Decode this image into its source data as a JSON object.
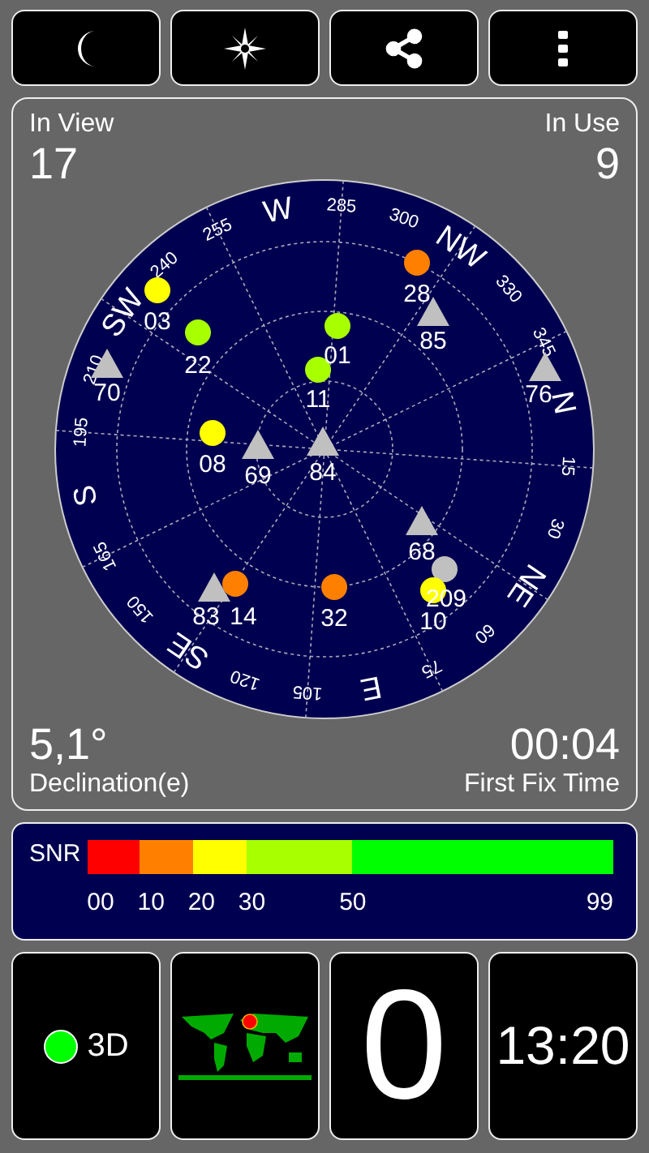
{
  "counts": {
    "in_view_label": "In View",
    "in_view": "17",
    "in_use_label": "In Use",
    "in_use": "9"
  },
  "dial_labels": [
    {
      "text": "N",
      "kind": "direction"
    },
    {
      "text": "15",
      "kind": "degree"
    },
    {
      "text": "30",
      "kind": "degree"
    },
    {
      "text": "NE",
      "kind": "direction"
    },
    {
      "text": "60",
      "kind": "degree"
    },
    {
      "text": "75",
      "kind": "degree"
    },
    {
      "text": "E",
      "kind": "direction"
    },
    {
      "text": "105",
      "kind": "degree"
    },
    {
      "text": "120",
      "kind": "degree"
    },
    {
      "text": "SE",
      "kind": "direction"
    },
    {
      "text": "150",
      "kind": "degree"
    },
    {
      "text": "165",
      "kind": "degree"
    },
    {
      "text": "S",
      "kind": "direction"
    },
    {
      "text": "195",
      "kind": "degree"
    },
    {
      "text": "210",
      "kind": "degree"
    },
    {
      "text": "SW",
      "kind": "direction"
    },
    {
      "text": "240",
      "kind": "degree"
    },
    {
      "text": "255",
      "kind": "degree"
    },
    {
      "text": "W",
      "kind": "direction"
    },
    {
      "text": "285",
      "kind": "degree"
    },
    {
      "text": "300",
      "kind": "degree"
    },
    {
      "text": "NW",
      "kind": "direction"
    },
    {
      "text": "330",
      "kind": "degree"
    },
    {
      "text": "345",
      "kind": "degree"
    }
  ],
  "satellites": [
    {
      "label": "28",
      "kind": "circle",
      "color": "#ff8000"
    },
    {
      "label": "03",
      "kind": "circle",
      "color": "#ffff00"
    },
    {
      "label": "85",
      "kind": "triangle",
      "color": "#c0c0c0"
    },
    {
      "label": "22",
      "kind": "circle",
      "color": "#a8ff00"
    },
    {
      "label": "01",
      "kind": "circle",
      "color": "#a8ff00"
    },
    {
      "label": "70",
      "kind": "triangle",
      "color": "#c0c0c0"
    },
    {
      "label": "11",
      "kind": "circle",
      "color": "#a8ff00"
    },
    {
      "label": "76",
      "kind": "triangle",
      "color": "#c0c0c0"
    },
    {
      "label": "08",
      "kind": "circle",
      "color": "#ffff00"
    },
    {
      "label": "69",
      "kind": "triangle",
      "color": "#c0c0c0"
    },
    {
      "label": "84",
      "kind": "triangle",
      "color": "#c0c0c0"
    },
    {
      "label": "68",
      "kind": "triangle",
      "color": "#c0c0c0"
    },
    {
      "label": "209",
      "kind": "circle",
      "color": "#c0c0c0"
    },
    {
      "label": "83",
      "kind": "triangle",
      "color": "#c0c0c0"
    },
    {
      "label": "14",
      "kind": "circle",
      "color": "#ff8000"
    },
    {
      "label": "32",
      "kind": "circle",
      "color": "#ff8000"
    },
    {
      "label": "10",
      "kind": "circle",
      "color": "#ffff00"
    }
  ],
  "declination": {
    "value": "5,1°",
    "label": "Declination(e)"
  },
  "first_fix": {
    "value": "00:04",
    "label": "First Fix Time"
  },
  "snr": {
    "label": "SNR",
    "segments": [
      {
        "label": "00",
        "color": "#ff0000"
      },
      {
        "label": "10",
        "color": "#ff8000"
      },
      {
        "label": "20",
        "color": "#ffff00"
      },
      {
        "label": "30",
        "color": "#a8ff00"
      },
      {
        "label": "50",
        "color": "#00ff00"
      }
    ],
    "end_label": "99"
  },
  "fix": {
    "label": "3D",
    "color": "#00ff00"
  },
  "speed": "0",
  "clock": "13:20"
}
